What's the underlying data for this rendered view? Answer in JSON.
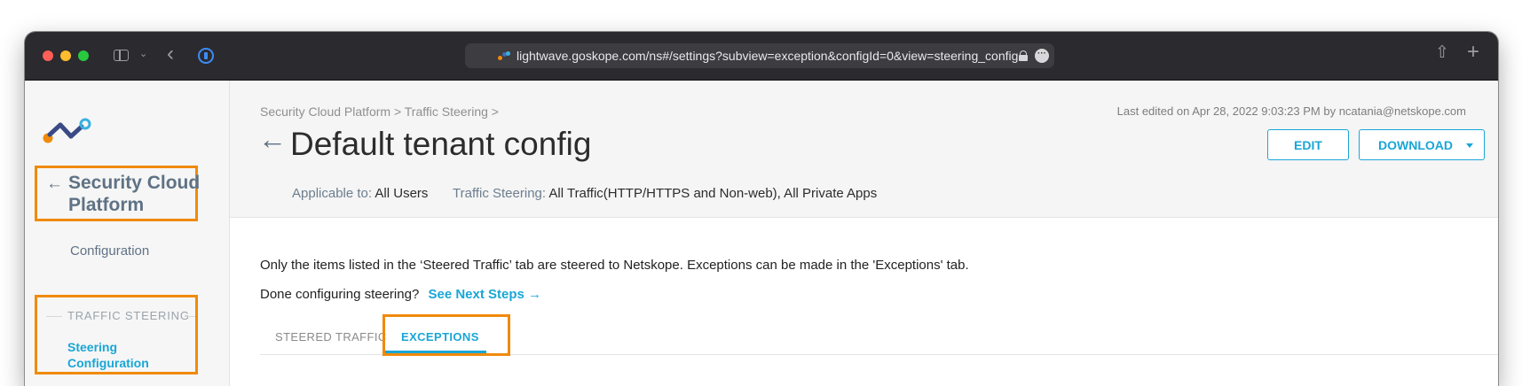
{
  "browser": {
    "url": "lightwave.goskope.com/ns#/settings?subview=exception&configId=0&view=steering_config"
  },
  "sidebar": {
    "back_title": "Security Cloud Platform",
    "configuration_label": "Configuration",
    "section_label": "TRAFFIC STEERING",
    "steering_item": "Steering Configuration"
  },
  "header": {
    "breadcrumb": "Security Cloud Platform > Traffic Steering >",
    "last_edited": "Last edited on Apr 28, 2022 9:03:23 PM by ncatania@netskope.com",
    "title": "Default tenant config",
    "edit_label": "EDIT",
    "download_label": "DOWNLOAD",
    "applicable_label": "Applicable to:",
    "applicable_value": "All Users",
    "traffic_label": "Traffic Steering:",
    "traffic_value": "All Traffic(HTTP/HTTPS and Non-web), All Private Apps"
  },
  "content": {
    "info_text": "Only the items listed in the ‘Steered Traffic’ tab are steered to Netskope. Exceptions can be made in the 'Exceptions' tab.",
    "next_prompt": "Done configuring steering?",
    "next_link": "See Next Steps →",
    "tabs": [
      {
        "label": "STEERED TRAFFIC",
        "active": false
      },
      {
        "label": "EXCEPTIONS",
        "active": true
      }
    ]
  },
  "colors": {
    "accent": "#19a6d6",
    "highlight_outline": "#f08a0c",
    "chrome_bg": "#2b2a2e",
    "sidebar_text": "#5f7285"
  },
  "icons": [
    "sidebar-toggle-icon",
    "chevron-down-icon",
    "back-arrow-icon",
    "password-manager-icon",
    "favicon-icon",
    "lock-icon",
    "more-icon",
    "share-icon",
    "new-tab-plus-icon",
    "netskope-logo",
    "caret-down-icon"
  ]
}
